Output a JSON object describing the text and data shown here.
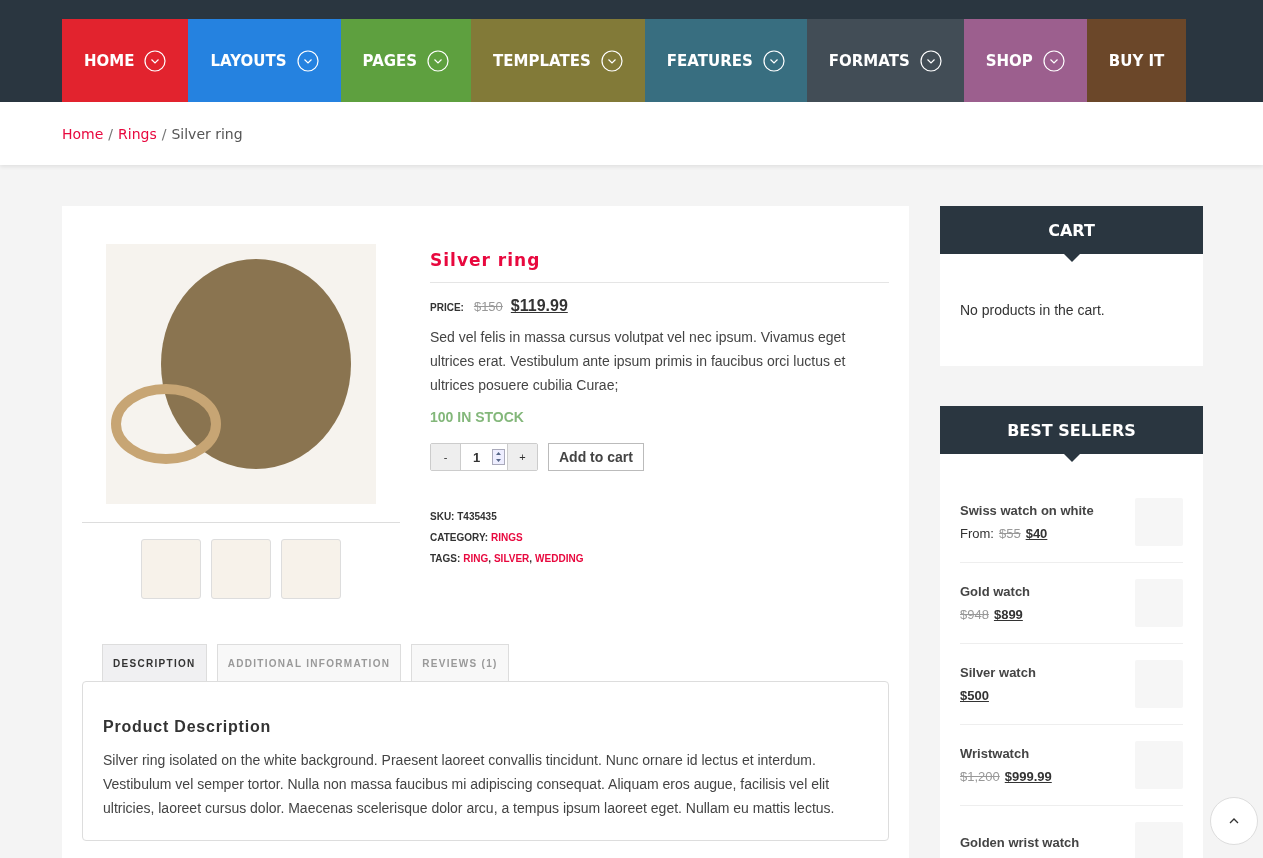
{
  "nav": [
    {
      "label": "HOME",
      "color": "#e2232e",
      "dropdown": true
    },
    {
      "label": "LAYOUTS",
      "color": "#2582e0",
      "dropdown": true
    },
    {
      "label": "PAGES",
      "color": "#5ea03f",
      "dropdown": true
    },
    {
      "label": "TEMPLATES",
      "color": "#827a38",
      "dropdown": true
    },
    {
      "label": "FEATURES",
      "color": "#386e80",
      "dropdown": true
    },
    {
      "label": "FORMATS",
      "color": "#424d56",
      "dropdown": true
    },
    {
      "label": "SHOP",
      "color": "#9c5f8e",
      "dropdown": true
    },
    {
      "label": "BUY IT",
      "color": "#6b4729",
      "dropdown": false
    }
  ],
  "breadcrumb_separator": "/",
  "tag_separator": ",",
  "breadcrumb": [
    {
      "label": "Home",
      "link": true
    },
    {
      "label": "Rings",
      "link": true
    },
    {
      "label": "Silver ring",
      "link": false
    }
  ],
  "product": {
    "title": "Silver ring",
    "price_label": "PRICE:",
    "old_price": "$150",
    "price": "$119.99",
    "summary": "Sed vel felis in massa cursus volutpat vel nec ipsum. Vivamus eget ultrices erat. Vestibulum ante ipsum primis in faucibus orci luctus et ultrices posuere cubilia Curae;",
    "stock": "100 IN STOCK",
    "quantity": {
      "minus": "-",
      "value": "1",
      "plus": "+"
    },
    "add_button": "Add to cart",
    "sku_label": "SKU:",
    "sku": "T435435",
    "category_label": "CATEGORY:",
    "categories": [
      "RINGS"
    ],
    "tags_label": "TAGS:",
    "tags": [
      "RING",
      "SILVER",
      "WEDDING"
    ]
  },
  "tabs": [
    {
      "label": "DESCRIPTION",
      "selected": true
    },
    {
      "label": "ADDITIONAL INFORMATION",
      "selected": false
    },
    {
      "label": "REVIEWS (1)",
      "selected": false
    }
  ],
  "description": {
    "heading": "Product Description",
    "text": "Silver ring isolated on the white background. Praesent laoreet convallis tincidunt. Nunc ornare id lectus et interdum. Vestibulum vel semper tortor. Nulla non massa faucibus mi adipiscing consequat. Aliquam eros augue, facilisis vel elit ultricies, laoreet cursus dolor. Maecenas scelerisque dolor arcu, a tempus ipsum laoreet eget. Nullam eu mattis lectus."
  },
  "cart": {
    "title": "CART",
    "empty_text": "No products in the cart."
  },
  "best_sellers": {
    "title": "BEST SELLERS",
    "items": [
      {
        "name": "Swiss watch on white",
        "prefix": "From:",
        "old_price": "$55",
        "price": "$40"
      },
      {
        "name": "Gold watch",
        "old_price": "$948",
        "price": "$899"
      },
      {
        "name": "Silver watch",
        "price": "$500"
      },
      {
        "name": "Wristwatch",
        "old_price": "$1,200",
        "price": "$999.99"
      },
      {
        "name": "Golden wrist watch"
      }
    ]
  }
}
